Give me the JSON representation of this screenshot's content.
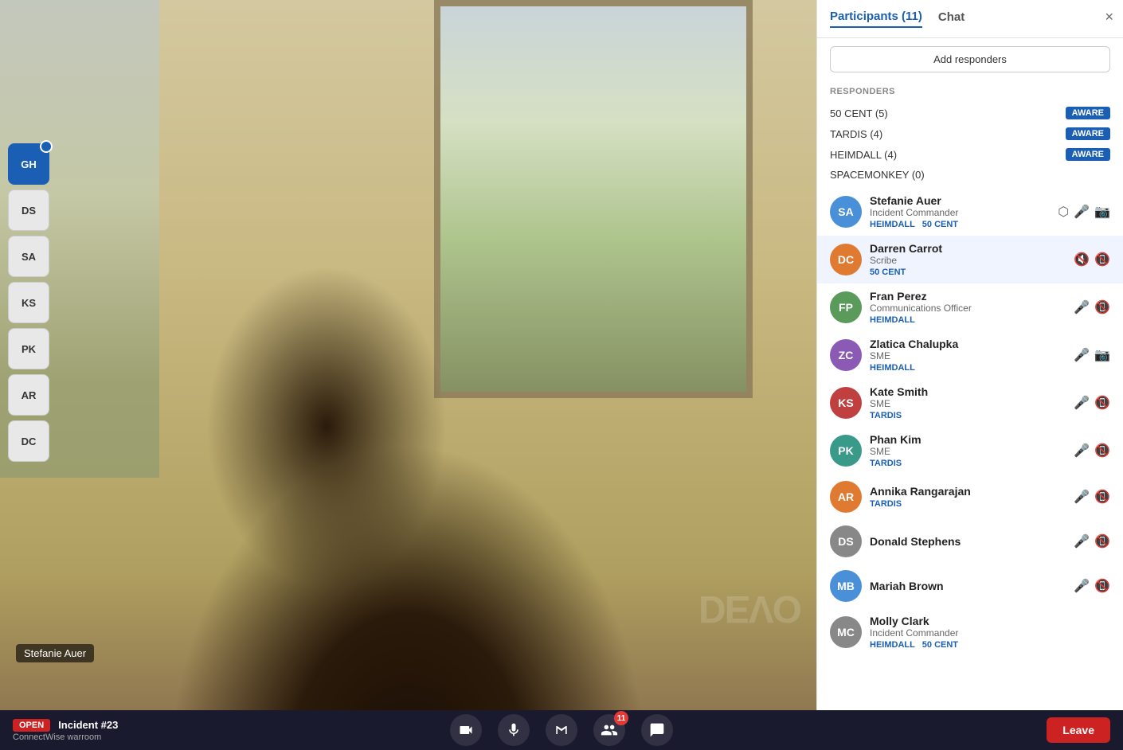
{
  "panel": {
    "tabs": [
      {
        "label": "Participants (11)",
        "id": "participants",
        "active": true
      },
      {
        "label": "Chat",
        "id": "chat",
        "active": false
      }
    ],
    "close_label": "×",
    "add_responders_label": "Add responders",
    "responders_section_label": "RESPONDERS",
    "responder_groups": [
      {
        "name": "50 CENT (5)",
        "badge": "AWARE"
      },
      {
        "name": "TARDIS (4)",
        "badge": "AWARE"
      },
      {
        "name": "HEIMDALL (4)",
        "badge": "AWARE"
      },
      {
        "name": "SPACEMONKEY (0)",
        "badge": null
      }
    ],
    "participants": [
      {
        "name": "Stefanie Auer",
        "role": "Incident Commander",
        "tags": [
          "HEIMDALL",
          "50 CENT"
        ],
        "initials": "SA",
        "avatar_color": "av-blue",
        "mic": true,
        "cam": true,
        "share": true,
        "mic_muted": false,
        "cam_muted": false
      },
      {
        "name": "Darren Carrot",
        "role": "Scribe",
        "tags": [
          "50 CENT"
        ],
        "initials": "DC",
        "avatar_color": "av-orange",
        "mic": true,
        "cam": true,
        "mic_muted": true,
        "cam_muted": true,
        "highlighted": true
      },
      {
        "name": "Fran Perez",
        "role": "Communications Officer",
        "tags": [
          "HEIMDALL"
        ],
        "initials": "FP",
        "avatar_color": "av-green",
        "mic": true,
        "cam": true,
        "mic_muted": false,
        "cam_muted": true
      },
      {
        "name": "Zlatica Chalupka",
        "role": "SME",
        "tags": [
          "HEIMDALL"
        ],
        "initials": "ZC",
        "avatar_color": "av-purple",
        "mic": true,
        "cam": true,
        "mic_muted": false,
        "cam_muted": false
      },
      {
        "name": "Kate Smith",
        "role": "SME",
        "tags": [
          "TARDIS"
        ],
        "initials": "KS",
        "avatar_color": "av-red",
        "mic": true,
        "cam": true,
        "mic_muted": false,
        "cam_muted": true
      },
      {
        "name": "Phan Kim",
        "role": "SME",
        "tags": [
          "TARDIS"
        ],
        "initials": "PK",
        "avatar_color": "av-teal",
        "mic": true,
        "cam": true,
        "mic_muted": false,
        "cam_muted": true
      },
      {
        "name": "Annika Rangarajan",
        "role": "",
        "tags": [
          "TARDIS"
        ],
        "initials": "AR",
        "avatar_color": "av-orange",
        "mic": true,
        "cam": true,
        "mic_muted": false,
        "cam_muted": true
      },
      {
        "name": "Donald Stephens",
        "role": "",
        "tags": [],
        "initials": "DS",
        "avatar_color": "av-gray",
        "mic": true,
        "cam": true,
        "mic_muted": false,
        "cam_muted": true
      },
      {
        "name": "Mariah Brown",
        "role": "",
        "tags": [],
        "initials": "MB",
        "avatar_color": "av-blue",
        "mic": true,
        "cam": true,
        "mic_muted": false,
        "cam_muted": true
      },
      {
        "name": "Molly Clark",
        "role": "Incident Commander",
        "tags": [
          "HEIMDALL",
          "50 CENT"
        ],
        "initials": "MC",
        "avatar_color": "av-gray",
        "mic": false,
        "cam": false,
        "mic_muted": false,
        "cam_muted": false
      }
    ]
  },
  "sidebar_avatars": [
    {
      "initials": "GH",
      "active": true,
      "badge": true
    },
    {
      "initials": "DS",
      "active": false
    },
    {
      "initials": "SA",
      "active": false
    },
    {
      "initials": "KS",
      "active": false
    },
    {
      "initials": "PK",
      "active": false
    },
    {
      "initials": "AR",
      "active": false
    },
    {
      "initials": "DC",
      "active": false
    }
  ],
  "speaker_label": "Stefanie Auer",
  "watermark": "DEVO",
  "bottom_bar": {
    "incident_badge": "OPEN",
    "incident_title": "Incident #23",
    "incident_subtitle": "ConnectWise warroom",
    "leave_label": "Leave",
    "participant_count": "11"
  }
}
